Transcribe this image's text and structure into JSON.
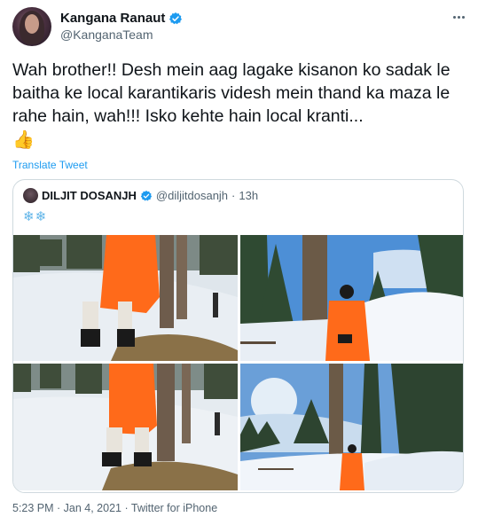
{
  "author": {
    "name": "Kangana Ranaut",
    "handle": "@KanganaTeam",
    "verified": true,
    "accent": "#1d9bf0"
  },
  "tweet": {
    "text": "Wah brother!! Desh mein aag lagake kisanon ko sadak le baitha ke local karantikaris videsh mein thand ka maza le rahe hain, wah!!! Isko kehte hain local kranti...",
    "emoji": "👍",
    "translate_label": "Translate Tweet"
  },
  "quoted": {
    "name": "DILJIT DOSANJH",
    "handle": "@diljitdosanjh",
    "time": "13h",
    "separator": "·",
    "text": "❄❄",
    "photos": [
      "snow-photo-1",
      "snow-photo-2",
      "snow-photo-3",
      "snow-photo-4"
    ]
  },
  "footer": {
    "timestamp": "5:23 PM · Jan 4, 2021 · Twitter for iPhone"
  },
  "icons": [
    "verified-icon",
    "more-icon",
    "thumbs-up-icon",
    "snowflake-icon"
  ]
}
